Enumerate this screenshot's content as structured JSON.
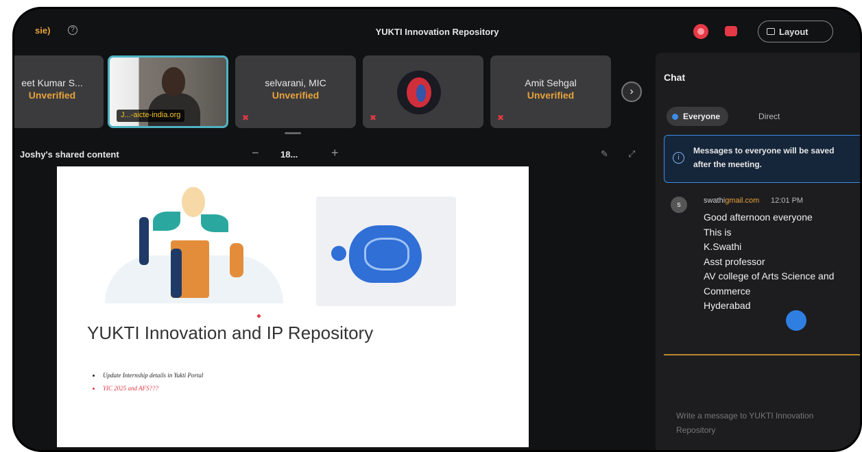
{
  "app": {
    "title": "YUKTI Innovation Repository",
    "recording_chip": "sie)",
    "layout_button": "Layout"
  },
  "participants": [
    {
      "name": "eet Kumar S...",
      "status": "Unverified"
    },
    {
      "name": "",
      "video_label": "J...-aicte-india.org"
    },
    {
      "name": "selvarani, MIC",
      "status": "Unverified"
    },
    {
      "name": "",
      "avatar": "red-logo-avatar"
    },
    {
      "name": "Amit Sehgal",
      "status": "Unverified"
    }
  ],
  "share": {
    "label": "Joshy's shared content",
    "zoom_level": "18...",
    "zoom_out": "−",
    "zoom_in": "+"
  },
  "slide": {
    "title": "YUKTI Innovation and IP Repository",
    "bullets": [
      {
        "text": "Update Internship details in Yukti Portal",
        "color": "#222222"
      },
      {
        "text": "YIC 2025 and AFS???",
        "color": "#e53946"
      }
    ]
  },
  "chat": {
    "title": "Chat",
    "tabs": [
      "Everyone",
      "Direct"
    ],
    "notice": "Messages to everyone will be saved\nafter the meeting.",
    "message": {
      "avatar_initial": "s",
      "sender_user": "swathi",
      "sender_domain": "gmail.com",
      "time": "12:01 PM",
      "lines": [
        "Good afternoon everyone",
        "This is",
        "K.Swathi",
        "Asst professor",
        "AV college of Arts Science and",
        "Commerce",
        "Hyderabad"
      ]
    },
    "compose_placeholder": "Write a message to YUKTI Innovation\nRepository"
  },
  "colors": {
    "accent_blue": "#3a8ce6",
    "record_red": "#e53946",
    "unverified_orange": "#e8a33c"
  }
}
